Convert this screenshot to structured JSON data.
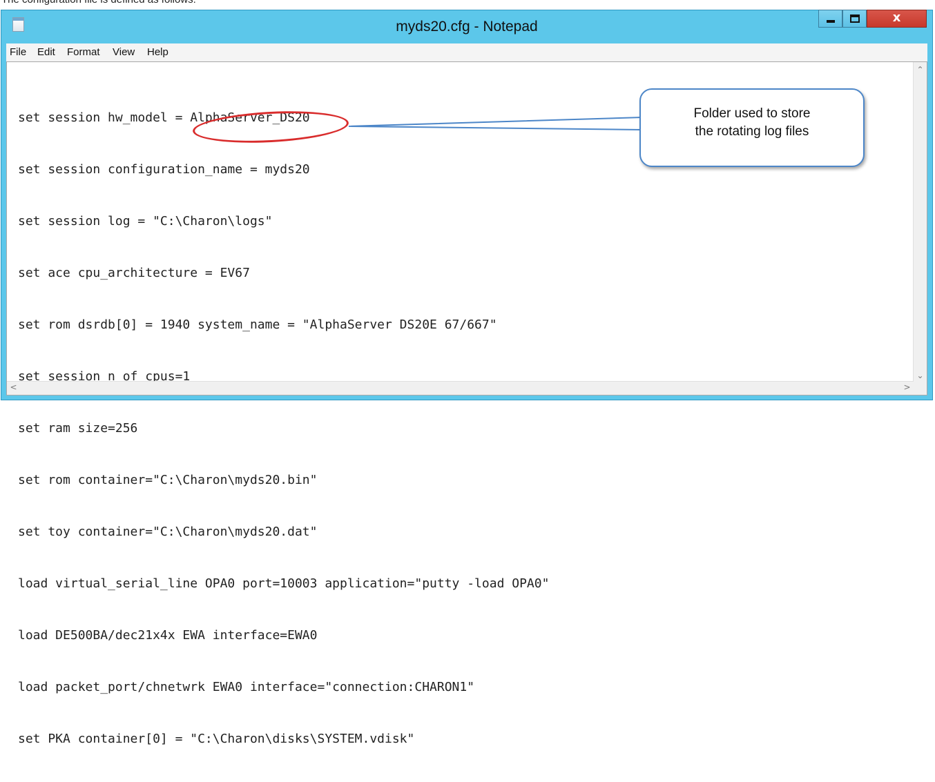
{
  "page_caption": "The configuration file is defined as follows:",
  "window": {
    "title": "myds20.cfg - Notepad",
    "close_label": "x",
    "colors": {
      "titlebar": "#5cc7ea",
      "close": "#c7392c"
    }
  },
  "menu": {
    "items": [
      {
        "label": "File"
      },
      {
        "label": "Edit"
      },
      {
        "label": "Format"
      },
      {
        "label": "View"
      },
      {
        "label": "Help"
      }
    ]
  },
  "editor": {
    "lines": [
      "set session hw_model = AlphaServer_DS20",
      "set session configuration_name = myds20",
      "set session log = \"C:\\Charon\\logs\"",
      "set ace cpu_architecture = EV67",
      "set rom dsrdb[0] = 1940 system_name = \"AlphaServer DS20E 67/667\"",
      "set session n_of_cpus=1",
      "set ram size=256",
      "set rom container=\"C:\\Charon\\myds20.bin\"",
      "set toy container=\"C:\\Charon\\myds20.dat\"",
      "load virtual_serial_line OPA0 port=10003 application=\"putty -load OPA0\"",
      "load DE500BA/dec21x4x EWA interface=EWA0",
      "load packet_port/chnetwrk EWA0 interface=\"connection:CHARON1\"",
      "set PKA container[0] = \"C:\\Charon\\disks\\SYSTEM.vdisk\""
    ]
  },
  "annotation": {
    "callout_text": "Folder used to store\nthe rotating log files",
    "colors": {
      "highlight": "#d92c2c",
      "callout_border": "#4c86c8"
    }
  }
}
